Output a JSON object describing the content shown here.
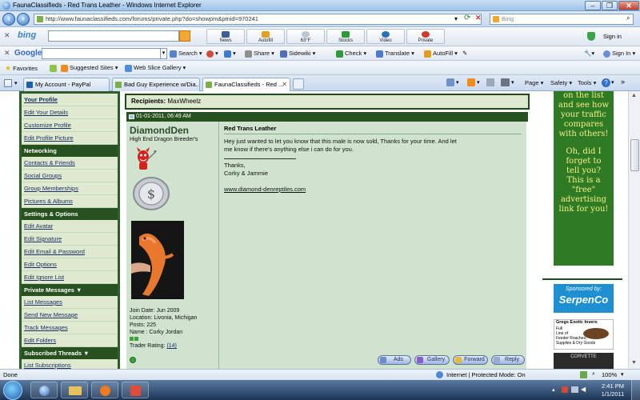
{
  "window": {
    "title": "FaunaClassifieds - Red Trans Leather - Windows Internet Explorer"
  },
  "address": {
    "url": "http://www.faunaclassifieds.com/forums/private.php?do=showpm&pmid=970241",
    "search_engine": "Bing"
  },
  "bing_toolbar": {
    "logo": "bing",
    "buttons": [
      {
        "label": "News",
        "icon": "news-icon"
      },
      {
        "label": "Autofill",
        "icon": "autofill-icon"
      },
      {
        "label": "63°F",
        "icon": "weather-icon"
      },
      {
        "label": "Stocks",
        "icon": "stocks-icon"
      },
      {
        "label": "Video",
        "icon": "video-icon"
      },
      {
        "label": "Private",
        "icon": "private-icon"
      }
    ],
    "signin": "Sign in"
  },
  "google_toolbar": {
    "logo": "Google",
    "search_label": "Search",
    "items": [
      "Share",
      "Sidewiki",
      "Check",
      "Translate",
      "AutoFill"
    ],
    "signin": "Sign In"
  },
  "favorites_bar": {
    "favorites_label": "Favorites",
    "items": [
      "Suggested Sites",
      "Web Slice Gallery"
    ]
  },
  "tabs": [
    {
      "label": "My Account - PayPal",
      "active": false
    },
    {
      "label": "Bad Guy Experience w/Dia...",
      "active": false
    },
    {
      "label": "FaunaClassifieds - Red ...",
      "active": true
    }
  ],
  "command_bar": {
    "page": "Page",
    "safety": "Safety",
    "tools": "Tools"
  },
  "leftnav": [
    {
      "type": "item",
      "label": "Your Profile",
      "current": true
    },
    {
      "type": "item",
      "label": "Edit Your Details"
    },
    {
      "type": "item",
      "label": "Customize Profile"
    },
    {
      "type": "item",
      "label": "Edit Profile Picture"
    },
    {
      "type": "head",
      "label": "Networking"
    },
    {
      "type": "item",
      "label": "Contacts & Friends"
    },
    {
      "type": "item",
      "label": "Social Groups"
    },
    {
      "type": "item",
      "label": "Group Memberships"
    },
    {
      "type": "item",
      "label": "Pictures & Albums"
    },
    {
      "type": "head",
      "label": "Settings & Options"
    },
    {
      "type": "item",
      "label": "Edit Avatar"
    },
    {
      "type": "item",
      "label": "Edit Signature"
    },
    {
      "type": "item",
      "label": "Edit Email & Password"
    },
    {
      "type": "item",
      "label": "Edit Options"
    },
    {
      "type": "item",
      "label": "Edit Ignore List"
    },
    {
      "type": "head",
      "label": "Private Messages ▼"
    },
    {
      "type": "item",
      "label": "List Messages"
    },
    {
      "type": "item",
      "label": "Send New Message"
    },
    {
      "type": "item",
      "label": "Track Messages"
    },
    {
      "type": "item",
      "label": "Edit Folders"
    },
    {
      "type": "head",
      "label": "Subscribed Threads ▼"
    },
    {
      "type": "item",
      "label": "List Subscriptions"
    }
  ],
  "post": {
    "recipients_label": "Recipients:",
    "recipients": "MaxWheelz",
    "date": "01-01-2011, 06:49 AM",
    "user": {
      "name": "DiamondDen",
      "title": "High End Dragon Breeder's",
      "join_date": "Join Date: Jun 2009",
      "location": "Location: Livonia, Michigan",
      "posts": "Posts: 225",
      "name_line": "Name : Corky Jordan",
      "trader_rating_label": "Trader Rating:",
      "trader_rating": "(14)"
    },
    "subject": "Red Trans Leather",
    "body_line1": "Hey just wanted to let you know that this male is now sold, Thanks for your time. And let",
    "body_line2": "me know if there's anything else i can do for you.",
    "signoff": "Thanks,",
    "signature": "Corky & Jammie",
    "link": "www.diamond-denreptiles.com",
    "buttons": [
      "Ads",
      "Gallery",
      "Forward",
      "Reply"
    ]
  },
  "right_ad": {
    "lines": [
      "on the list",
      "and see how",
      "your traffic",
      "compares",
      "with others!",
      "",
      "Oh, did I",
      "forget to",
      "tell you?",
      "This is a",
      "\"free\"",
      "advertising",
      "link for you!"
    ],
    "sponsor_title": "Sponsored by:",
    "sponsor_name": "SerpenCo",
    "roach_title": "Gregs Exotic Invers",
    "roach_lines": [
      "Full",
      "Line of",
      "Feeder Roaches,",
      "Supplies & Dry Goods"
    ],
    "corvette": "CORVETTE"
  },
  "status": {
    "left": "Done",
    "zone": "Internet | Protected Mode: On",
    "zoom": "100%"
  },
  "clock": {
    "time": "2:41 PM",
    "date": "1/1/2011"
  },
  "colors": {
    "nav_green": "#2f5e2c",
    "nav_item": "#dfe9cf",
    "post_bg": "#cfe3cf",
    "ad_green": "#2f7a24",
    "ad_text": "#f7f089"
  }
}
